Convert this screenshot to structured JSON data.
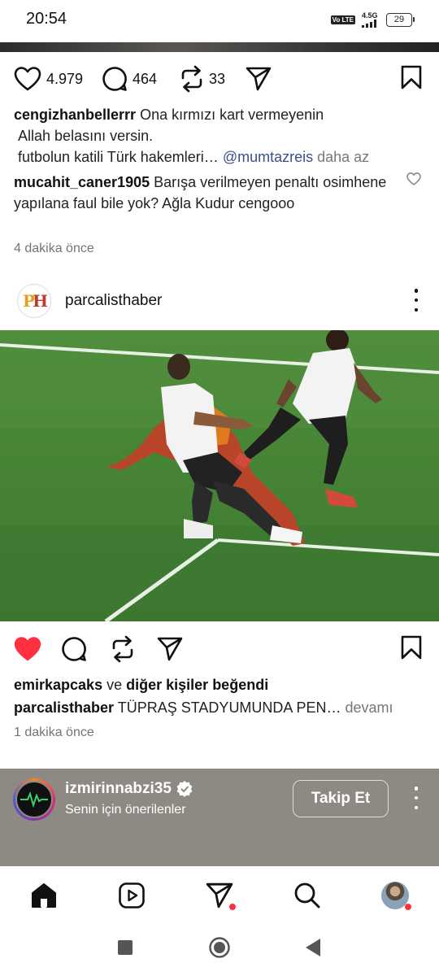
{
  "status_bar": {
    "time": "20:54",
    "volte": "Vo LTE",
    "network": "4.5G",
    "battery": "29"
  },
  "post1": {
    "likes": "4.979",
    "comments": "464",
    "reposts": "33",
    "caption_user": "cengizhanbellerrr",
    "caption_line1": "Ona kırmızı kart vermeyenin",
    "caption_line2": "Allah belasını versin.",
    "caption_line3": "futbolun katili Türk hakemleri…",
    "caption_mention": "@mumtazreis",
    "caption_less": "daha az",
    "comment_user": "mucahit_caner1905",
    "comment_text": "Barışa verilmeyen penaltı osimhene yapılana faul bile yok? Ağla Kudur cengooo",
    "time": "4 dakika önce"
  },
  "post2": {
    "username": "parcalisthaber",
    "avatar_letters": {
      "p": "P",
      "h": "H"
    },
    "liked_by_user": "emirkapcaks",
    "liked_by_connector": "ve",
    "liked_by_others": "diğer kişiler beğendi",
    "caption_user": "parcalisthaber",
    "caption_text": "TÜPRAŞ STADYUMUNDA PEN…",
    "caption_more": "devamı",
    "time": "1 dakika önce",
    "liked": true
  },
  "suggested": {
    "username": "izmirinnabzi35",
    "subtitle": "Senin için önerilenler",
    "follow_label": "Takip Et",
    "verified": true
  },
  "bottom_nav": {
    "items": [
      "home-icon",
      "reels-icon",
      "direct-icon",
      "search-icon",
      "profile-avatar"
    ],
    "notification_color": "#ff3040"
  },
  "colors": {
    "like_red": "#ff3040",
    "mention_blue": "#3a4f8f",
    "muted_gray": "#737373"
  }
}
